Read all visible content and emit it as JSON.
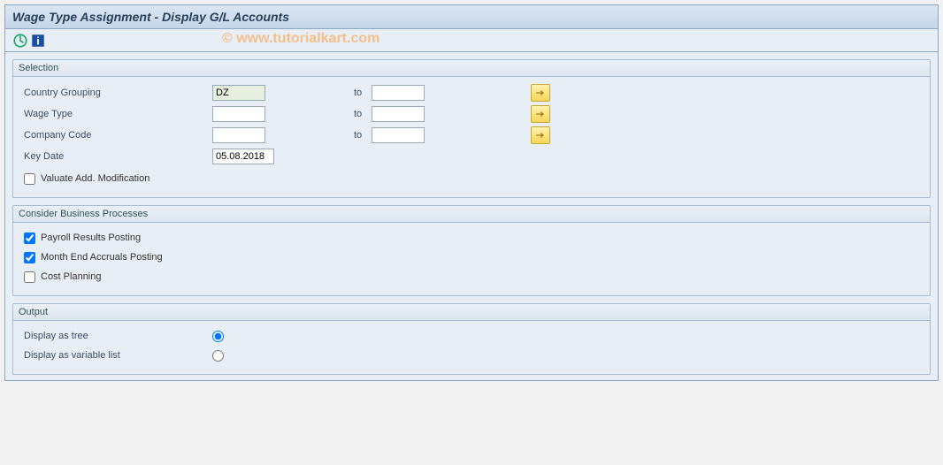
{
  "window": {
    "title": "Wage Type Assignment - Display G/L Accounts"
  },
  "watermark": "© www.tutorialkart.com",
  "selection": {
    "title": "Selection",
    "rows": {
      "country_grouping": {
        "label": "Country Grouping",
        "from": "DZ",
        "to_label": "to",
        "to": ""
      },
      "wage_type": {
        "label": "Wage Type",
        "from": "",
        "to_label": "to",
        "to": ""
      },
      "company_code": {
        "label": "Company Code",
        "from": "",
        "to_label": "to",
        "to": ""
      },
      "key_date": {
        "label": "Key Date",
        "value": "05.08.2018"
      },
      "valuate": {
        "label": "Valuate Add. Modification",
        "checked": false
      }
    }
  },
  "processes": {
    "title": "Consider Business Processes",
    "payroll": {
      "label": "Payroll Results Posting",
      "checked": true
    },
    "monthend": {
      "label": "Month End Accruals Posting",
      "checked": true
    },
    "costplan": {
      "label": "Cost Planning",
      "checked": false
    }
  },
  "output": {
    "title": "Output",
    "tree": {
      "label": "Display as tree",
      "selected": true
    },
    "varlist": {
      "label": "Display as variable list",
      "selected": false
    }
  }
}
